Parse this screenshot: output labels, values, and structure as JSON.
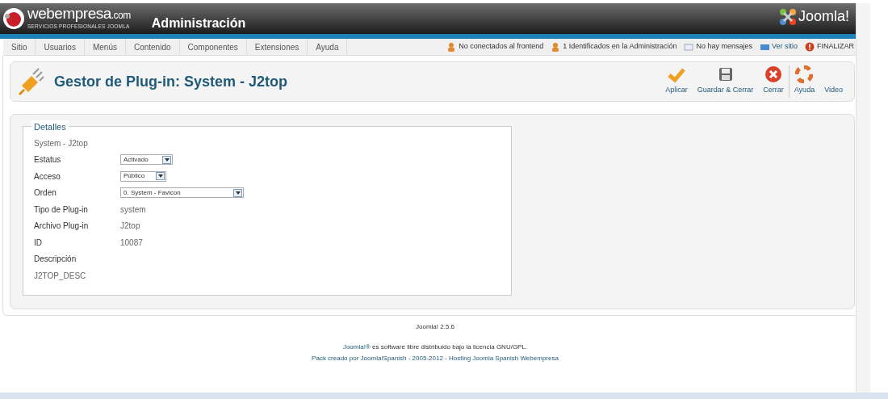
{
  "header": {
    "brand": "webempresa",
    "brand_suffix": ".com",
    "tagline": "SERVICIOS PROFESIONALES JOOMLA",
    "title": "Administración",
    "logo_text": "Joomla!"
  },
  "menu": [
    {
      "label": "Sitio"
    },
    {
      "label": "Usuarios"
    },
    {
      "label": "Menús"
    },
    {
      "label": "Contenido"
    },
    {
      "label": "Componentes"
    },
    {
      "label": "Extensiones"
    },
    {
      "label": "Ayuda"
    }
  ],
  "status": [
    {
      "kind": "users",
      "label": "No conectados al frontend"
    },
    {
      "kind": "admins",
      "label": "1 Identificados en la Administración"
    },
    {
      "kind": "messages",
      "label": "No hay mensajes"
    },
    {
      "kind": "view",
      "label": "Ver sitio"
    },
    {
      "kind": "logout",
      "label": "FINALIZAR"
    }
  ],
  "toolbar": {
    "title": "Gestor de Plug-in: System - J2top",
    "buttons": [
      {
        "kind": "apply",
        "label": "Aplicar"
      },
      {
        "kind": "save",
        "label": "Guardar & Cerrar"
      },
      {
        "kind": "close",
        "label": "Cerrar"
      },
      {
        "kind": "help",
        "label": "Ayuda"
      },
      {
        "kind": "video",
        "label": "Video"
      }
    ]
  },
  "details": {
    "legend": "Detalles",
    "name": "System - J2top",
    "fields": [
      {
        "kind": "select",
        "label": "Estatus",
        "value": "Activado"
      },
      {
        "kind": "select",
        "label": "Acceso",
        "value": "Público"
      },
      {
        "kind": "select-wide",
        "label": "Orden",
        "value": "0. System - Favicon"
      },
      {
        "kind": "text",
        "label": "Tipo de Plug-in",
        "value": "system"
      },
      {
        "kind": "text",
        "label": "Archivo Plug-in",
        "value": "J2top"
      },
      {
        "kind": "text",
        "label": "ID",
        "value": "10087"
      },
      {
        "kind": "label",
        "label": "Descripción"
      }
    ],
    "description": "J2TOP_DESC"
  },
  "footer": {
    "version": "Joomla! 2.5.6",
    "license_link": "Joomla!®",
    "license_text": " es software libre distribuido bajo la licencia GNU/GPL.",
    "credits": "Pack creado por Joomla!Spanish - 2005-2012 - Hosting Joomla Spanish Webempresa"
  }
}
